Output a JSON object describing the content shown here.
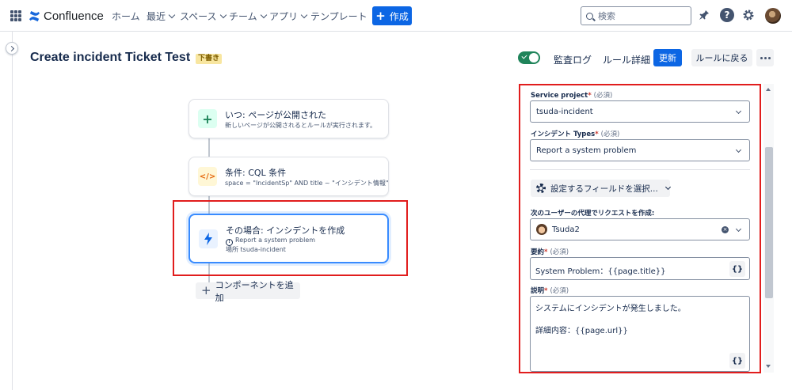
{
  "topnav": {
    "app_name": "Confluence",
    "items": [
      "ホーム",
      "最近",
      "スペース",
      "チーム",
      "アプリ",
      "テンプレート"
    ],
    "create_label": "作成",
    "search_placeholder": "検索"
  },
  "header": {
    "title": "Create incident Ticket Test",
    "draft_badge": "下書き",
    "audit_log": "監査ログ",
    "rule_details": "ルール詳細",
    "update": "更新",
    "back_to_rules": "ルールに戻る"
  },
  "flow": {
    "trigger": {
      "title": "いつ: ページが公開された",
      "subtitle": "新しいページが公開されるとルールが実行されます。"
    },
    "condition": {
      "title": "条件: CQL 条件",
      "subtitle": "space = \"IncidentSp\" AND title ~ \"インシデント情報\""
    },
    "action": {
      "title": "その場合: インシデントを作成",
      "line1": "Report a system problem",
      "line2": "場所 tsuda-incident"
    },
    "add_component": "コンポーネントを追加"
  },
  "panel": {
    "service_project": {
      "label": "Service project",
      "optional": "(必須)",
      "value": "tsuda-incident"
    },
    "incident_type": {
      "label": "インシデント Types",
      "optional": "(必須)",
      "value": "Report a system problem"
    },
    "field_picker": "設定するフィールドを選択...",
    "on_behalf": {
      "label": "次のユーザーの代理でリクエストを作成:",
      "value": "Tsuda2"
    },
    "summary": {
      "label": "要約",
      "optional": "(必須)",
      "value": "System Problem：{{page.title}}",
      "brace": "{}"
    },
    "description": {
      "label": "説明",
      "optional": "(必須)",
      "line1": "システムにインシデントが発生しました。",
      "line2": "詳細内容：{{page.url}}",
      "brace": "{}"
    }
  },
  "colors": {
    "primary": "#0c66e4",
    "highlight": "#e11d1d",
    "toggle_on": "#1f845a"
  }
}
